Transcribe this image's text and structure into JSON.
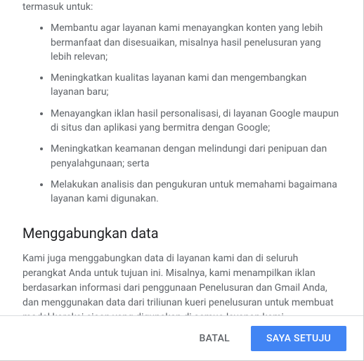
{
  "intro_fragment": "termasuk untuk:",
  "bullets": [
    "Membantu agar layanan kami menayangkan konten yang lebih bermanfaat dan disesuaikan, misalnya hasil penelusuran yang lebih relevan;",
    "Meningkatkan kualitas layanan kami dan mengembangkan layanan baru;",
    "Menayangkan iklan hasil personalisasi, di layanan Google maupun di situs dan aplikasi yang bermitra dengan Google;",
    "Meningkatkan keamanan dengan melindungi dari penipuan dan penyalahgunaan; serta",
    "Melakukan analisis dan pengukuran untuk memahami bagaimana layanan kami digunakan."
  ],
  "section": {
    "title": "Menggabungkan data",
    "body": "Kami juga menggabungkan data di layanan kami dan di seluruh perangkat Anda untuk tujuan ini. Misalnya, kami menampilkan iklan berdasarkan informasi dari penggunaan Penelusuran dan Gmail Anda, dan menggunakan data dari triliunan kueri penelusuran untuk membuat model koreksi ejaan yang digunakan di semua layanan kami."
  },
  "footer": {
    "cancel_label": "BATAL",
    "agree_label": "SAYA SETUJU"
  }
}
